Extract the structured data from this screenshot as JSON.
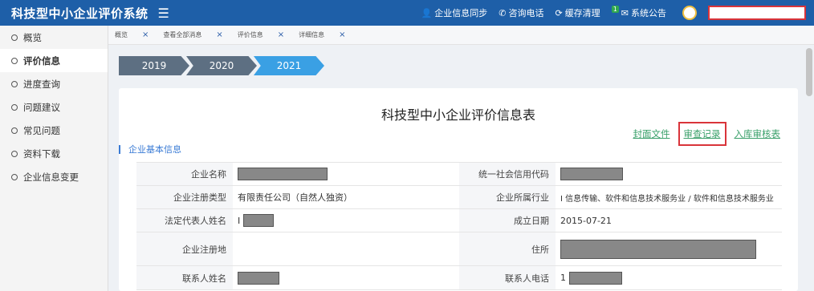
{
  "header": {
    "title": "科技型中小企业评价系统",
    "actions": [
      {
        "label": "企业信息同步",
        "icon": "person-icon"
      },
      {
        "label": "咨询电话",
        "icon": "phone-icon"
      },
      {
        "label": "缓存清理",
        "icon": "refresh-icon"
      },
      {
        "label": "系统公告",
        "icon": "mail-icon",
        "badge": "1"
      }
    ]
  },
  "sidebar": {
    "items": [
      {
        "label": "概览"
      },
      {
        "label": "评价信息"
      },
      {
        "label": "进度查询"
      },
      {
        "label": "问题建议"
      },
      {
        "label": "常见问题"
      },
      {
        "label": "资料下载"
      },
      {
        "label": "企业信息变更"
      }
    ],
    "active_index": 1
  },
  "tabs": [
    {
      "label": "概览"
    },
    {
      "label": "查看全部消息"
    },
    {
      "label": "评价信息"
    },
    {
      "label": "详细信息"
    }
  ],
  "years": [
    "2019",
    "2020",
    "2021"
  ],
  "active_year": "2021",
  "form": {
    "title": "科技型中小企业评价信息表",
    "links": {
      "cover": "封面文件",
      "review": "审查记录",
      "storage": "入库审核表"
    },
    "section": "企业基本信息",
    "rows": [
      {
        "l1": "企业名称",
        "v1": "",
        "l2": "统一社会信用代码",
        "v2": ""
      },
      {
        "l1": "企业注册类型",
        "v1": "有限责任公司（自然人独资）",
        "l2": "企业所属行业",
        "v2": "I 信息传输、软件和信息技术服务业 / 软件和信息技术服务业"
      },
      {
        "l1": "法定代表人姓名",
        "v1": "I",
        "l2": "成立日期",
        "v2": "2015-07-21"
      },
      {
        "l1": "企业注册地",
        "v1": "",
        "l2": "住所",
        "v2": ""
      },
      {
        "l1": "联系人姓名",
        "v1": "",
        "l2": "联系人电话",
        "v2": "1"
      }
    ]
  },
  "colors": {
    "header_bg": "#1e5fa8",
    "active_year": "#3aa0e4",
    "link_green": "#3aa06a",
    "highlight_red": "#d9343a"
  }
}
